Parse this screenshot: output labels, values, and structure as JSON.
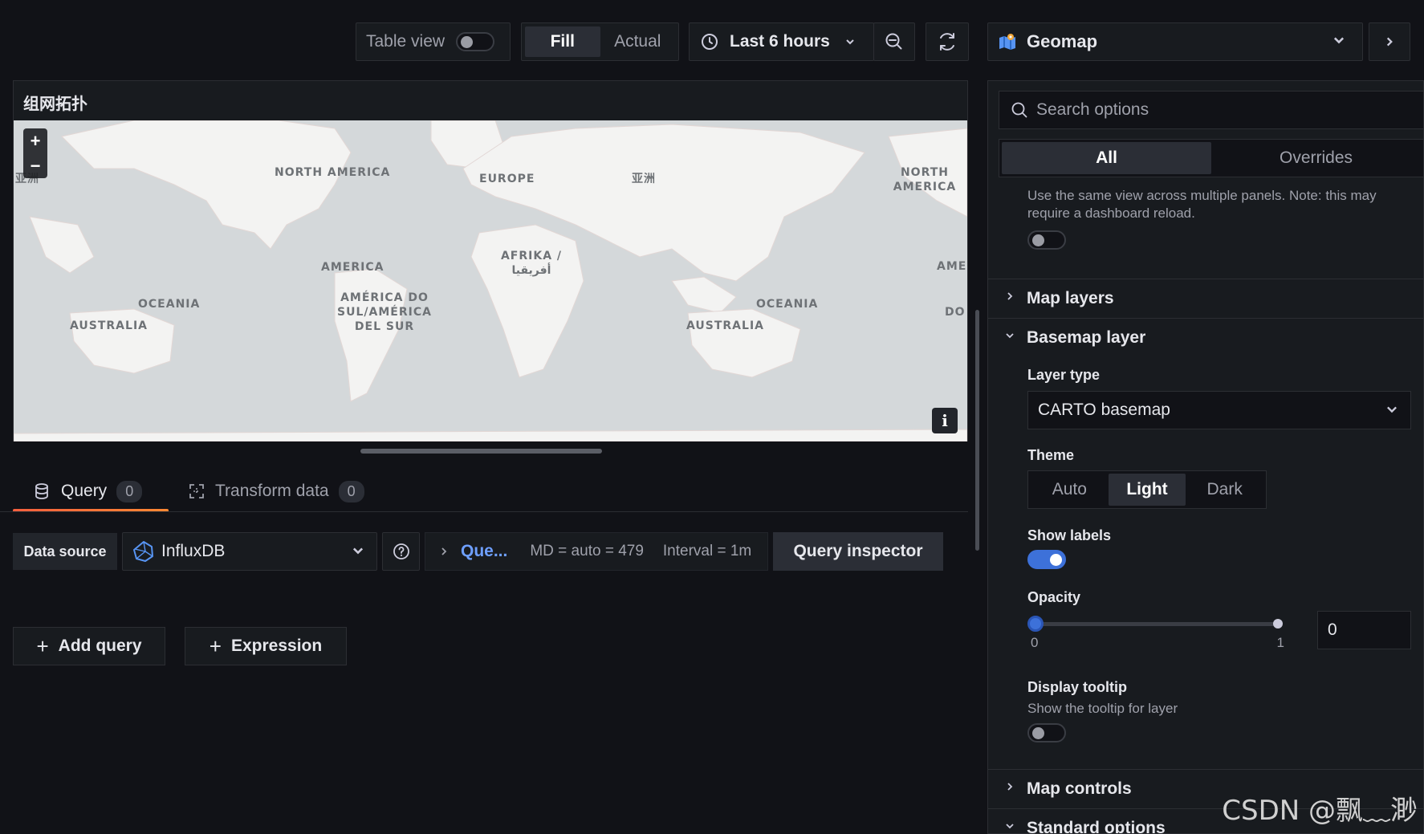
{
  "toolbar": {
    "table_view_label": "Table view",
    "table_view_on": false,
    "fill_label": "Fill",
    "actual_label": "Actual",
    "time_range": "Last 6 hours",
    "visualization": "Geomap"
  },
  "panel": {
    "title": "组网拓扑",
    "map_labels": [
      "NORTH AMERICA",
      "EUROPE",
      "亚洲",
      "NORTH AMERICA",
      "AMERICA",
      "AFRIKA / أفريقيا",
      "AMÉRICA DO SUL/AMÉRICA DEL SUR",
      "OCEANIA",
      "AUSTRALIA",
      "OCEANIA",
      "AUSTRALIA",
      "AME",
      "DO",
      "亚洲"
    ],
    "zoom_in": "+",
    "zoom_out": "−",
    "info": "i"
  },
  "query_tabs": [
    {
      "label": "Query",
      "count": "0"
    },
    {
      "label": "Transform data",
      "count": "0"
    }
  ],
  "query_row": {
    "ds_label": "Data source",
    "ds_value": "InfluxDB",
    "query_name": "Que...",
    "md": "MD = auto = 479",
    "interval": "Interval = 1m",
    "inspector": "Query inspector"
  },
  "actions": {
    "add_query": "Add query",
    "expression": "Expression"
  },
  "options": {
    "search_placeholder": "Search options",
    "tabs": [
      "All",
      "Overrides"
    ],
    "shared_desc": "Use the same view across multiple panels. Note: this may require a dashboard reload.",
    "sections": {
      "map_layers": "Map layers",
      "basemap_layer": "Basemap layer",
      "map_controls": "Map controls",
      "standard_options": "Standard options"
    },
    "layer_type_label": "Layer type",
    "layer_type_value": "CARTO basemap",
    "theme_label": "Theme",
    "theme_options": [
      "Auto",
      "Light",
      "Dark"
    ],
    "theme_selected": "Light",
    "show_labels_label": "Show labels",
    "show_labels_on": true,
    "opacity_label": "Opacity",
    "opacity_min": "0",
    "opacity_max": "1",
    "opacity_value": "0",
    "display_tooltip_label": "Display tooltip",
    "display_tooltip_desc": "Show the tooltip for layer",
    "display_tooltip_on": false
  },
  "watermark": "CSDN @飘﹏渺",
  "colors": {
    "accent": "#3d71d9",
    "tab_underline": "#f55f3e",
    "query_link": "#6e9fff"
  }
}
